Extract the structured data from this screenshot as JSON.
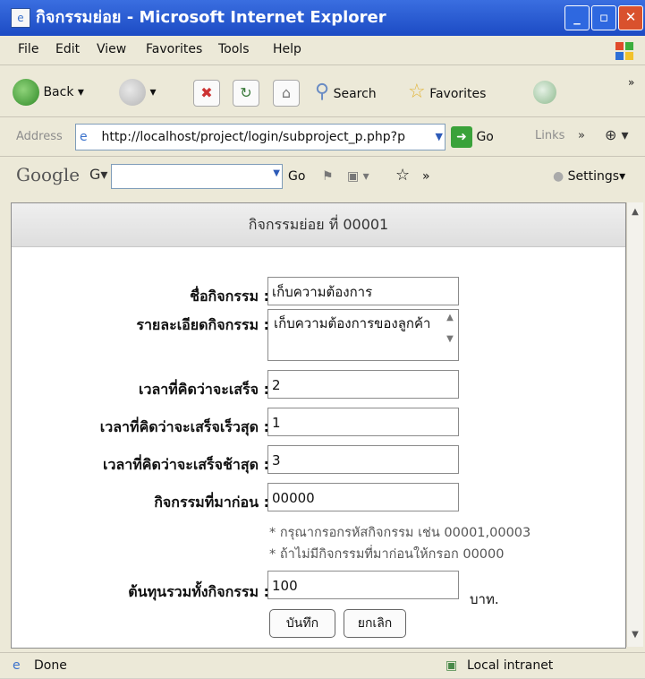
{
  "window": {
    "title": "กิจกรรมย่อย - Microsoft Internet Explorer",
    "controls": {
      "minimize": "_",
      "maximize": "▫",
      "close": "✕"
    }
  },
  "menu": [
    "File",
    "Edit",
    "View",
    "Favorites",
    "Tools",
    "Help"
  ],
  "toolbar": {
    "back": "Back",
    "search": "Search",
    "favorites": "Favorites",
    "more": "»"
  },
  "address": {
    "label": "Address",
    "url": "http://localhost/project/login/subproject_p.php?p",
    "go": "Go",
    "links": "Links",
    "more": "»"
  },
  "google": {
    "logo": "Google",
    "g_button": "G▾",
    "go": "Go",
    "more": "»",
    "settings": "Settings▾"
  },
  "form": {
    "heading": "กิจกรรมย่อย ที่ 00001",
    "fields": [
      {
        "label": "ชื่อกิจกรรม :",
        "value": "เก็บความต้องการ"
      },
      {
        "label": "รายละเอียดกิจกรรม :",
        "value": "เก็บความต้องการของลูกค้า"
      },
      {
        "label": "เวลาที่คิดว่าจะเสร็จ :",
        "value": "2"
      },
      {
        "label": "เวลาที่คิดว่าจะเสร็จเร็วสุด :",
        "value": "1"
      },
      {
        "label": "เวลาที่คิดว่าจะเสร็จช้าสุด :",
        "value": "3"
      },
      {
        "label": "กิจกรรมที่มาก่อน :",
        "value": "00000"
      },
      {
        "label": "ต้นทุนรวมทั้งกิจกรรม :",
        "value": "100"
      }
    ],
    "notes": [
      "* กรุณากรอกรหัสกิจกรรม เช่น 00001,00003",
      "* ถ้าไม่มีกิจกรรมที่มาก่อนให้กรอก 00000"
    ],
    "unit": "บาท.",
    "save": "บันทึก",
    "cancel": "ยกเลิก"
  },
  "status": {
    "left": "Done",
    "right": "Local intranet"
  }
}
